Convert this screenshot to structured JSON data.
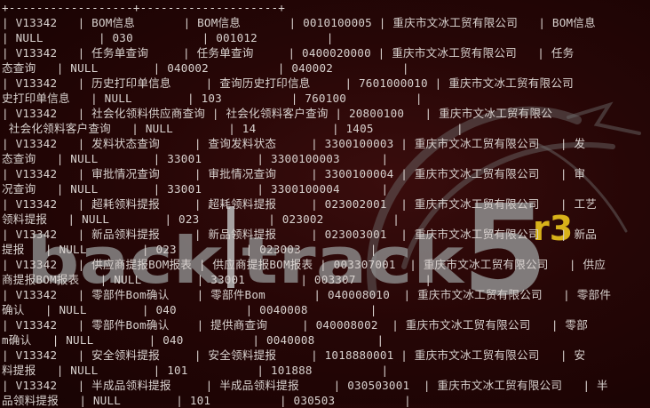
{
  "wallpaper": {
    "brand": "back|track",
    "version": "5",
    "release": "r3",
    "colors": {
      "background": "#260606",
      "logo": "#8a8a8a",
      "accent": "#d8b21a"
    }
  },
  "terminal": {
    "lines": [
      "+------------------+--------------------+",
      "| V13342   | BOM信息       | BOM信息       | 0010100005 | 重庆市文冰工贸有限公司   | BOM信息",
      "| NULL        | 030          | 001012          |",
      "| V13342   | 任务单查询     | 任务单查询     | 0400020000 | 重庆市文冰工贸有限公司   | 任务",
      "态查询   | NULL        | 040002          | 040002          |",
      "| V13342   | 历史打印单信息     | 查询历史打印信息     | 7601000010 | 重庆市文冰工贸有限公司",
      "史打印单信息   | NULL        | 103          | 760100          |",
      "| V13342   | 社会化领料供应商查询 | 社会化领料客户查询 | 20800100   | 重庆市文冰工贸有限公",
      " 社会化领料客户查询   | NULL        | 14           | 1405            |",
      "| V13342   | 发料状态查询     | 查询发料状态     | 3300100003 | 重庆市文冰工贸有限公司   | 发",
      "态查询   | NULL        | 33001        | 3300100003      |",
      "| V13342   | 审批情况查询     | 审批情况查询     | 3300100004 | 重庆市文冰工贸有限公司   | 审",
      "况查询   | NULL        | 33001        | 3300100004      |",
      "| V13342   | 超耗领料提报     | 超耗领料提报     | 023002001  | 重庆市文冰工贸有限公司   | 工艺",
      "领料提报   | NULL        | 023          | 023002          |",
      "| V13342   | 新品领料提报     | 新品领料提报     | 023003001  | 重庆市文冰工贸有限公司   | 新品",
      "提报   | NULL        | 023          | 023003          |",
      "| V13342   | 供应商提报BOM报表 | 供应商提报BOM报表 | 003307001  | 重庆市文冰工贸有限公司   | 供应",
      "商提报BOM报表   | NULL        | 33001        | 003307          |",
      "| V13342   | 零部件Bom确认    | 零部件Bom       | 040008010  | 重庆市文冰工贸有限公司   | 零部件",
      "确认   | NULL        | 040          | 0040008         |",
      "| V13342   | 零部件Bom确认    | 提供商查询     | 040008002  | 重庆市文冰工贸有限公司   | 零部",
      "m确认   | NULL        | 040          | 0040008         |",
      "| V13342   | 安全领料提报     | 安全领料提报     | 1018880001 | 重庆市文冰工贸有限公司   | 安",
      "料提报   | NULL        | 101          | 101888          |",
      "| V13342   | 半成品领料提报     | 半成品领料提报     | 030503001  | 重庆市文冰工贸有限公司   | 半",
      "品领料提报   | NULL        | 101          | 030503          |"
    ]
  }
}
